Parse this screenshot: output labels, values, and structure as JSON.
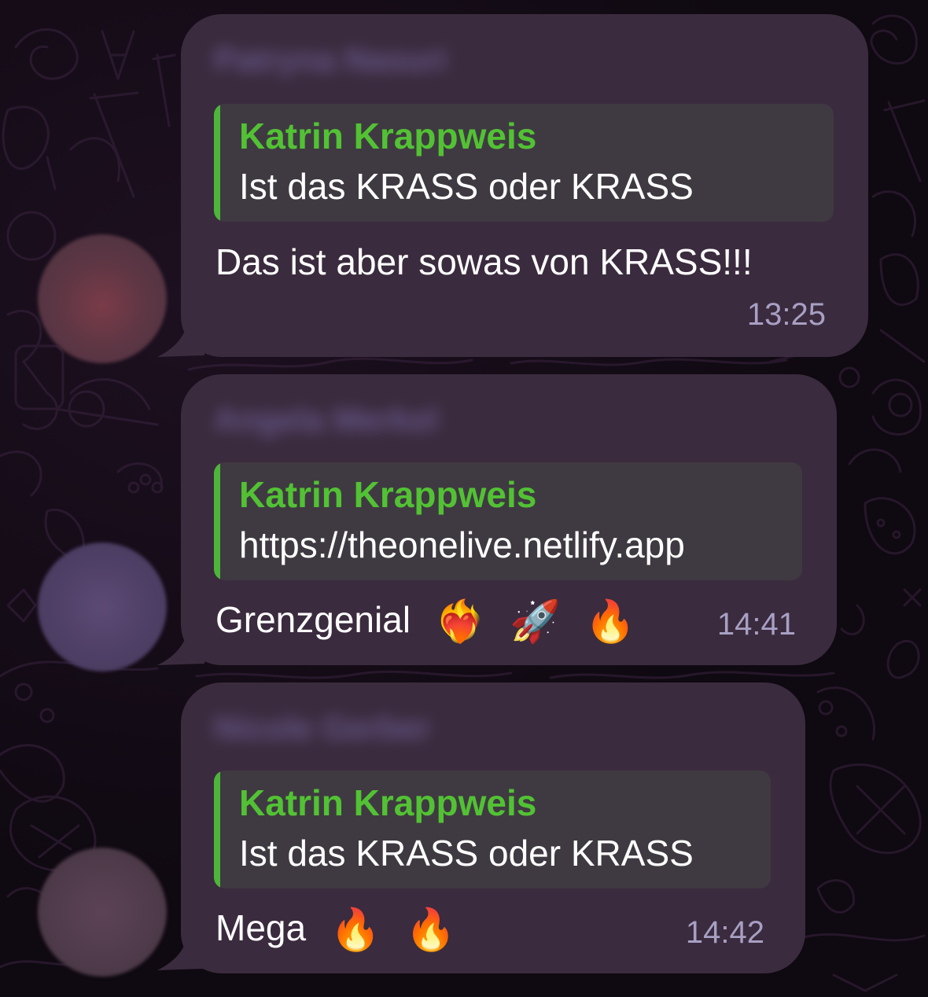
{
  "colors": {
    "background": "#120b14",
    "bubble": "#3b2b3e",
    "quote_background": "#3f3a41",
    "quote_accent": "#4cb53a",
    "quote_author": "#52c234",
    "time": "#a7a0c4"
  },
  "messages": [
    {
      "sender_blurred": "Patryna Nasuri",
      "avatar_color": "#7a3b48",
      "reply": {
        "author": "Katrin Krappweis",
        "text": "Ist das KRASS oder KRASS"
      },
      "text": "Das ist aber sowas von KRASS!!!",
      "emojis": [],
      "time": "13:25"
    },
    {
      "sender_blurred": "Angela Merkel",
      "avatar_color": "#55446e",
      "reply": {
        "author": "Katrin Krappweis",
        "text": "https://theonelive.netlify.app"
      },
      "text": "Grenzgenial",
      "emojis": [
        "heart-on-fire",
        "rocket",
        "fire"
      ],
      "time": "14:41"
    },
    {
      "sender_blurred": "Nicole Gerber",
      "avatar_color": "#5a4356",
      "reply": {
        "author": "Katrin Krappweis",
        "text": "Ist das KRASS oder KRASS"
      },
      "text": "Mega",
      "emojis": [
        "fire",
        "fire"
      ],
      "time": "14:42"
    }
  ]
}
